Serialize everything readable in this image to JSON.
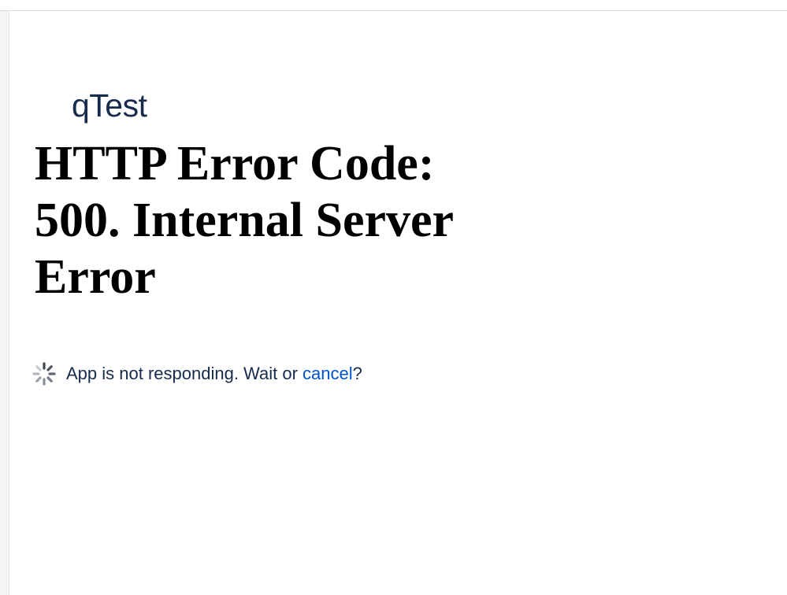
{
  "app": {
    "title": "qTest"
  },
  "error": {
    "heading": "HTTP Error Code: 500. Internal Server Error"
  },
  "status": {
    "message": "App is not responding. Wait or ",
    "cancel_label": "cancel",
    "suffix": "?",
    "icon": "loading-spinner-icon"
  },
  "colors": {
    "app_title": "#172b4d",
    "link": "#0052cc",
    "heading": "#000000"
  }
}
